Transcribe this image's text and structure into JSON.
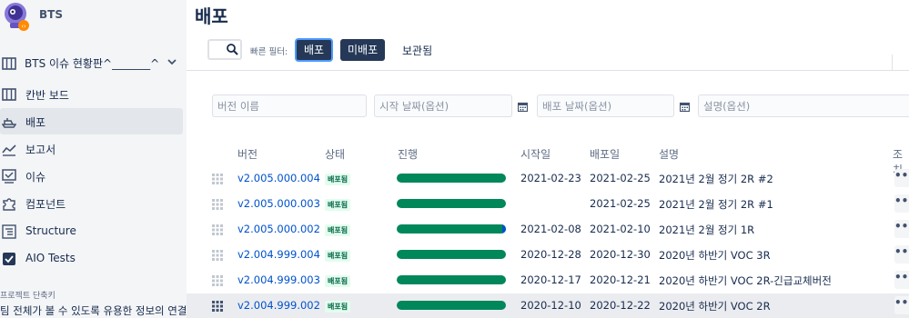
{
  "project": {
    "name": "BTS"
  },
  "sidebar": {
    "board_selector": "BTS 이슈 현황판^_______^",
    "items": [
      {
        "label": "칸반 보드",
        "icon": "board-icon"
      },
      {
        "label": "배포",
        "icon": "ship-icon",
        "active": true
      },
      {
        "label": "보고서",
        "icon": "chart-icon"
      },
      {
        "label": "이슈",
        "icon": "issues-icon"
      },
      {
        "label": "컴포넌트",
        "icon": "puzzle-icon"
      },
      {
        "label": "Structure",
        "icon": "structure-icon"
      },
      {
        "label": "AIO Tests",
        "icon": "checkbox-icon"
      }
    ],
    "shortcuts_title": "프로젝트 단축키",
    "shortcuts_desc": "팀 전체가 볼 수 있도록 유용한 정보의 연결을"
  },
  "main": {
    "title": "배포",
    "quick_filter_label": "빠른 필터:",
    "filters": [
      "배포",
      "미배포",
      "보관됨"
    ],
    "fields": {
      "version_name": "버전 이름",
      "start_date": "시작 날짜(옵션)",
      "release_date": "배포 날짜(옵션)",
      "description": "설명(옵션)"
    },
    "columns": [
      "버전",
      "상태",
      "진행",
      "시작일",
      "배포일",
      "설명",
      "조치"
    ],
    "rows": [
      {
        "version": "v2.005.000.004",
        "status": "배포됨",
        "progress": 1.0,
        "start": "2021-02-23",
        "release": "2021-02-25",
        "desc": "2021년 2월 정기 2R #2"
      },
      {
        "version": "v2.005.000.003",
        "status": "배포됨",
        "progress": 1.0,
        "start": "",
        "release": "2021-02-25",
        "desc": "2021년 2월 정기 2R #1"
      },
      {
        "version": "v2.005.000.002",
        "status": "배포됨",
        "progress": 0.97,
        "start": "2021-02-08",
        "release": "2021-02-10",
        "desc": "2021년 2월 정기 1R"
      },
      {
        "version": "v2.004.999.004",
        "status": "배포됨",
        "progress": 1.0,
        "start": "2020-12-28",
        "release": "2020-12-30",
        "desc": "2020년 하반기 VOC 3R"
      },
      {
        "version": "v2.004.999.003",
        "status": "배포됨",
        "progress": 1.0,
        "start": "2020-12-17",
        "release": "2020-12-21",
        "desc": "2020년 하반기 VOC 2R-긴급교체버전"
      },
      {
        "version": "v2.004.999.002",
        "status": "배포됨",
        "progress": 1.0,
        "start": "2020-12-10",
        "release": "2020-12-22",
        "desc": "2020년 하반기 VOC 2R"
      }
    ],
    "more_label": "•••"
  },
  "colors": {
    "accent": "#0052cc",
    "progress_done": "#00875a",
    "status_bg": "#e3fcef",
    "status_text": "#006644",
    "dark_button": "#253858"
  }
}
